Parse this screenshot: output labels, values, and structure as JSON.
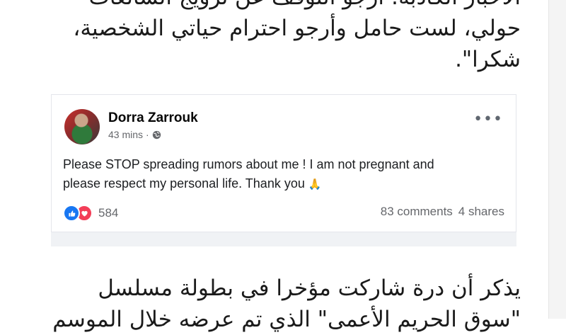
{
  "article": {
    "top_lines": [
      "الأخبار الكاذبة: أرجو التوقف عن ترويج الشائعات",
      "حولي، لست حامل وأرجو احترام حياتي الشخصية،",
      "شكرا\"."
    ],
    "bottom_lines": [
      "يذكر أن درة شاركت مؤخرا في بطولة مسلسل",
      "\"سوق الحريم الأعمى\" الذي تم عرضه خلال الموسم"
    ]
  },
  "post": {
    "author": "Dorra Zarrouk",
    "time": "43 mins",
    "separator": "·",
    "body_lines": [
      "Please STOP spreading rumors about me ! I am not pregnant and",
      "please respect my personal life. Thank you"
    ],
    "reactions_count": "584",
    "comments": "83 comments",
    "shares": "4 shares",
    "icons": {
      "globe": "globe-icon",
      "more": "more-options-icon",
      "pray": "folded-hands-emoji",
      "like": "like-icon",
      "love": "love-icon"
    }
  },
  "colors": {
    "brand_blue": "#1877f2",
    "love_red": "#f33e58",
    "muted_text": "#65676b"
  }
}
